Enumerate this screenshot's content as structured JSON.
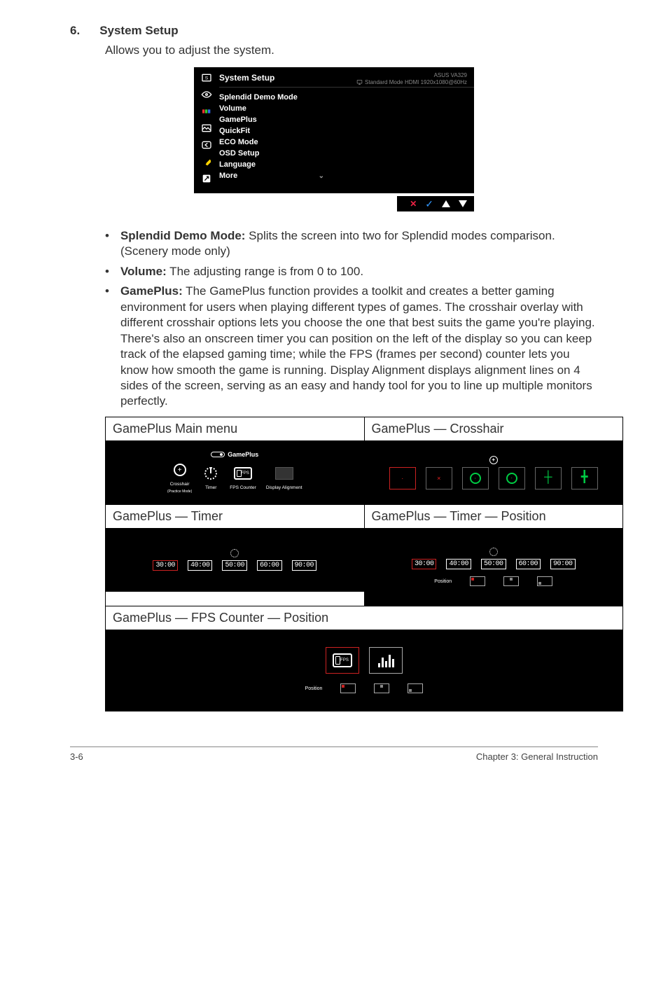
{
  "section": {
    "number": "6.",
    "title": "System Setup"
  },
  "intro": "Allows you to adjust the system.",
  "osd": {
    "title": "System Setup",
    "brand": "ASUS  VA329",
    "mode_line": "Standard Mode HDMI 1920x1080@60Hz",
    "items": [
      "Splendid Demo Mode",
      "Volume",
      "GamePlus",
      "QuickFit",
      "ECO Mode",
      "OSD Setup",
      "Language",
      "More"
    ]
  },
  "bullets": [
    {
      "label": "Splendid Demo Mode:",
      "text": " Splits the screen into two for Splendid modes comparison. (Scenery mode only)"
    },
    {
      "label": "Volume:",
      "text": " The adjusting range is from 0 to 100."
    },
    {
      "label": "GamePlus:",
      "text": " The GamePlus function provides a toolkit and creates a better gaming environment for users when playing different types of games. The crosshair overlay with different crosshair options lets you choose the one that best suits the game you're playing. There's also an onscreen timer you can position on the left of the display so you can keep track of the elapsed gaming time; while the FPS (frames per second) counter lets you know how smooth the game is running. Display Alignment displays alignment lines on 4 sides of the screen, serving as an easy and handy tool for you to line up multiple monitors perfectly."
    }
  ],
  "gp": {
    "main_title": "GamePlus Main menu",
    "crosshair_title": "GamePlus — Crosshair",
    "timer_title": "GamePlus — Timer",
    "timer_pos_title": "GamePlus — Timer — Position",
    "fps_title": "GamePlus — FPS Counter — Position",
    "main_header": "GamePlus",
    "main_icons": {
      "crosshair": "Crosshair",
      "crosshair_sub": "(Practice Mode)",
      "timer": "Timer",
      "fps": "FPS Counter",
      "align": "Display Alignment"
    },
    "timers": [
      "30:00",
      "40:00",
      "50:00",
      "60:00",
      "90:00"
    ],
    "position_label": "Position",
    "fps_text": "FPS"
  },
  "footer": {
    "left": "3-6",
    "right": "Chapter 3: General Instruction"
  }
}
